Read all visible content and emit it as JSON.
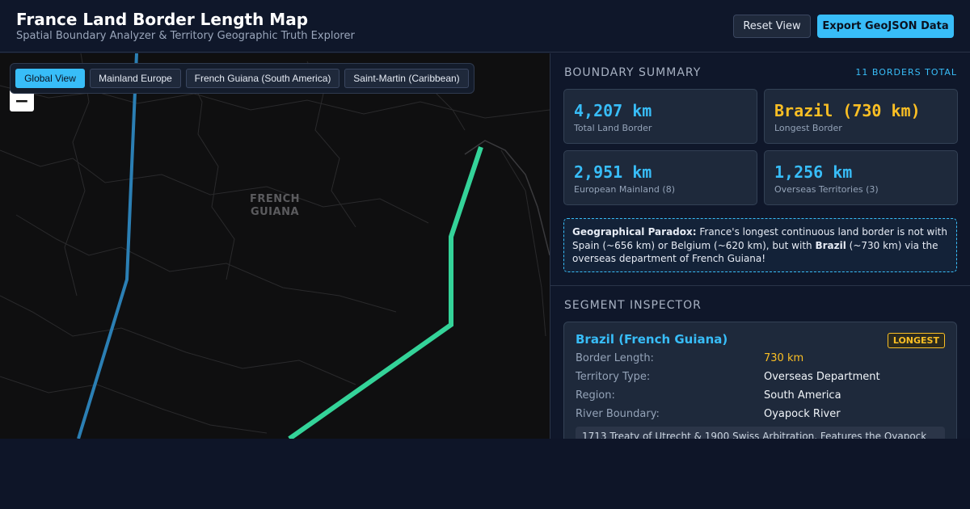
{
  "header": {
    "title": "France Land Border Length Map",
    "subtitle": "Spatial Boundary Analyzer & Territory Geographic Truth Explorer",
    "reset_label": "Reset View",
    "export_label": "Export GeoJSON Data"
  },
  "map": {
    "views": [
      "Global View",
      "Mainland Europe",
      "French Guiana (South America)",
      "Saint-Martin (Caribbean)"
    ],
    "active_view": "Global View",
    "zoom_out_label": "−",
    "place_label_line1": "FRENCH",
    "place_label_line2": "GUIANA",
    "colors": {
      "background": "#0f0f10",
      "brazil_border": "#34d399",
      "suriname_border": "#2b7fb4"
    }
  },
  "summary": {
    "title": "BOUNDARY SUMMARY",
    "count": "11 BORDERS TOTAL",
    "stats": [
      {
        "value": "4,207 km",
        "label": "Total Land Border",
        "color": "#38bdf8"
      },
      {
        "value": "Brazil (730 km)",
        "label": "Longest Border",
        "color": "#fbbf24"
      },
      {
        "value": "2,951 km",
        "label": "European Mainland (8)",
        "color": "#38bdf8"
      },
      {
        "value": "1,256 km",
        "label": "Overseas Territories (3)",
        "color": "#38bdf8"
      }
    ],
    "paradox": {
      "heading": "Geographical Paradox:",
      "text1": " France's longest continuous land border is not with Spain (~656 km) or Belgium (~620 km), but with ",
      "highlight": "Brazil",
      "text2": " (~730 km) via the overseas department of French Guiana!"
    }
  },
  "inspector": {
    "title": "SEGMENT INSPECTOR",
    "segment_name": "Brazil (French Guiana)",
    "badge": "LONGEST",
    "rows": [
      {
        "label": "Border Length:",
        "value": "730 km"
      },
      {
        "label": "Territory Type:",
        "value": "Overseas Department"
      },
      {
        "label": "Region:",
        "value": "South America"
      },
      {
        "label": "River Boundary:",
        "value": "Oyapock River"
      }
    ],
    "note": "1713 Treaty of Utrecht & 1900 Swiss Arbitration. Features the Oyapock"
  }
}
